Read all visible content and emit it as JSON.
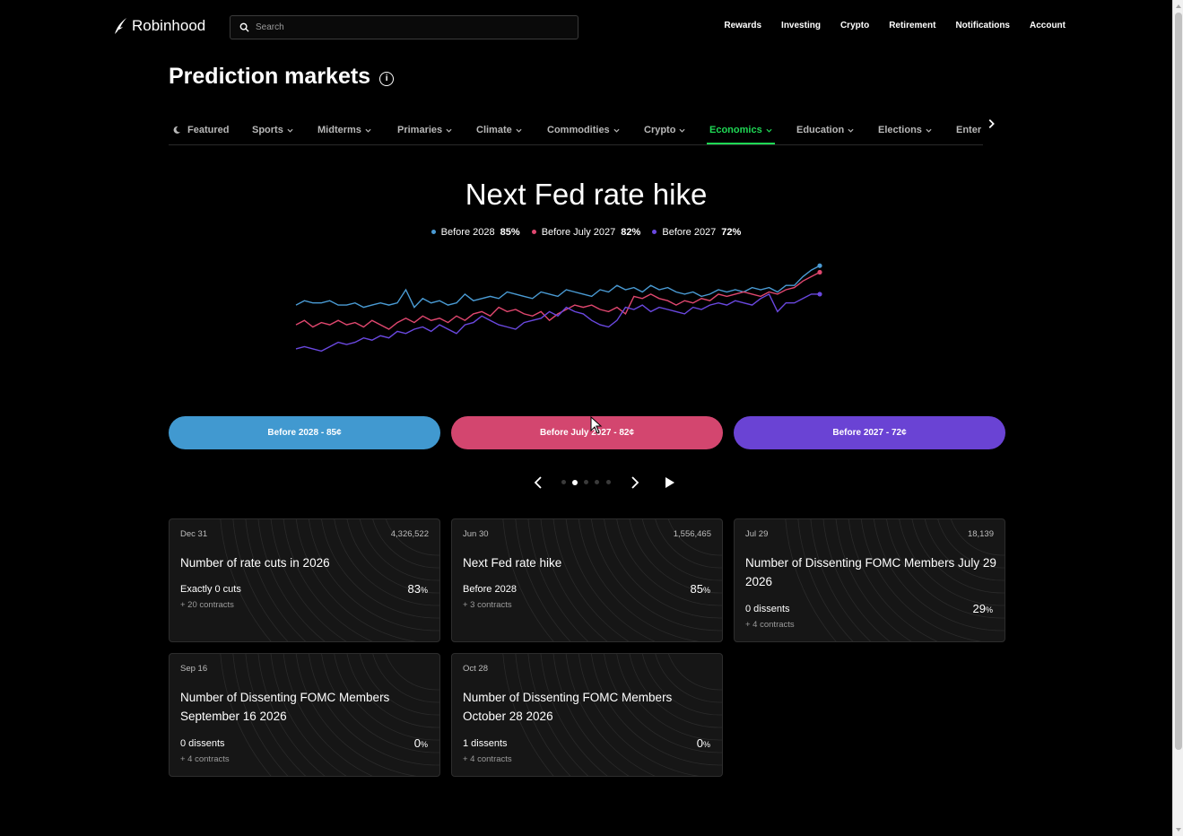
{
  "header": {
    "brand": "Robinhood",
    "search_placeholder": "Search",
    "nav": [
      "Rewards",
      "Investing",
      "Crypto",
      "Retirement",
      "Notifications",
      "Account"
    ]
  },
  "page": {
    "title": "Prediction markets"
  },
  "tabs": [
    {
      "label": "Featured",
      "active": false
    },
    {
      "label": "Sports",
      "active": false
    },
    {
      "label": "Midterms",
      "active": false
    },
    {
      "label": "Primaries",
      "active": false
    },
    {
      "label": "Climate",
      "active": false
    },
    {
      "label": "Commodities",
      "active": false
    },
    {
      "label": "Crypto",
      "active": false
    },
    {
      "label": "Economics",
      "active": true
    },
    {
      "label": "Education",
      "active": false
    },
    {
      "label": "Elections",
      "active": false
    },
    {
      "label": "Enter",
      "active": false
    }
  ],
  "hero": {
    "title": "Next Fed rate hike",
    "legend": [
      {
        "label": "Before 2028",
        "value": "85%",
        "color": "#4a9bd4"
      },
      {
        "label": "Before July 2027",
        "value": "82%",
        "color": "#e0476f"
      },
      {
        "label": "Before 2027",
        "value": "72%",
        "color": "#6a48e0"
      }
    ],
    "buttons": [
      {
        "label": "Before 2028 - 85¢",
        "color": "#4199d0"
      },
      {
        "label": "Before July 2027 - 82¢",
        "color": "#d3466f"
      },
      {
        "label": "Before 2027 - 72¢",
        "color": "#6a43d4"
      }
    ],
    "pager": {
      "pages": 5,
      "current": 2
    }
  },
  "chart_data": {
    "type": "line",
    "series": [
      {
        "name": "Before 2028",
        "color": "#4a9bd4",
        "values": [
          67,
          69,
          68,
          68,
          69,
          67,
          67,
          68,
          66,
          67,
          68,
          67,
          68,
          74,
          66,
          70,
          68,
          69,
          67,
          68,
          72,
          69,
          70,
          71,
          70,
          73,
          72,
          71,
          70,
          73,
          72,
          71,
          74,
          73,
          72,
          71,
          74,
          73,
          76,
          74,
          75,
          73,
          76,
          74,
          75,
          73,
          72,
          73,
          71,
          72,
          74,
          73,
          74,
          73,
          75,
          74,
          75,
          73,
          76,
          76,
          80,
          83,
          85
        ]
      },
      {
        "name": "Before July 2027",
        "color": "#e0476f",
        "values": [
          58,
          60,
          57,
          59,
          58,
          60,
          58,
          59,
          57,
          60,
          58,
          56,
          59,
          61,
          59,
          62,
          60,
          61,
          59,
          62,
          60,
          63,
          64,
          62,
          66,
          64,
          65,
          63,
          62,
          64,
          60,
          63,
          65,
          67,
          66,
          67,
          65,
          64,
          66,
          63,
          71,
          70,
          72,
          70,
          69,
          67,
          69,
          68,
          70,
          69,
          72,
          71,
          72,
          73,
          72,
          71,
          73,
          72,
          74,
          75,
          78,
          80,
          82
        ]
      },
      {
        "name": "Before 2027",
        "color": "#6a48e0",
        "values": [
          47,
          48,
          47,
          46,
          48,
          50,
          49,
          50,
          52,
          51,
          53,
          52,
          55,
          54,
          56,
          57,
          55,
          58,
          56,
          54,
          58,
          59,
          62,
          60,
          58,
          57,
          56,
          59,
          60,
          61,
          64,
          62,
          66,
          64,
          63,
          60,
          58,
          57,
          60,
          66,
          65,
          67,
          64,
          66,
          65,
          64,
          63,
          66,
          65,
          67,
          68,
          67,
          69,
          68,
          67,
          70,
          72,
          64,
          68,
          68,
          70,
          72,
          72
        ]
      }
    ],
    "ylim": [
      40,
      90
    ]
  },
  "cards": [
    {
      "date": "Dec 31",
      "volume": "4,326,522",
      "title": "Number of rate cuts in 2026",
      "option": "Exactly 0 cuts",
      "pct": "83",
      "more": "+ 20 contracts"
    },
    {
      "date": "Jun 30",
      "volume": "1,556,465",
      "title": "Next Fed rate hike",
      "option": "Before 2028",
      "pct": "85",
      "more": "+ 3 contracts"
    },
    {
      "date": "Jul 29",
      "volume": "18,139",
      "title": "Number of Dissenting FOMC Members July 29 2026",
      "option": "0 dissents",
      "pct": "29",
      "more": "+ 4 contracts"
    },
    {
      "date": "Sep 16",
      "volume": "",
      "title": "Number of Dissenting FOMC Members September 16 2026",
      "option": "0 dissents",
      "pct": "0",
      "more": "+ 4 contracts"
    },
    {
      "date": "Oct 28",
      "volume": "",
      "title": "Number of Dissenting FOMC Members October 28 2026",
      "option": "1 dissents",
      "pct": "0",
      "more": "+ 4 contracts"
    }
  ],
  "pct_unit": "%"
}
